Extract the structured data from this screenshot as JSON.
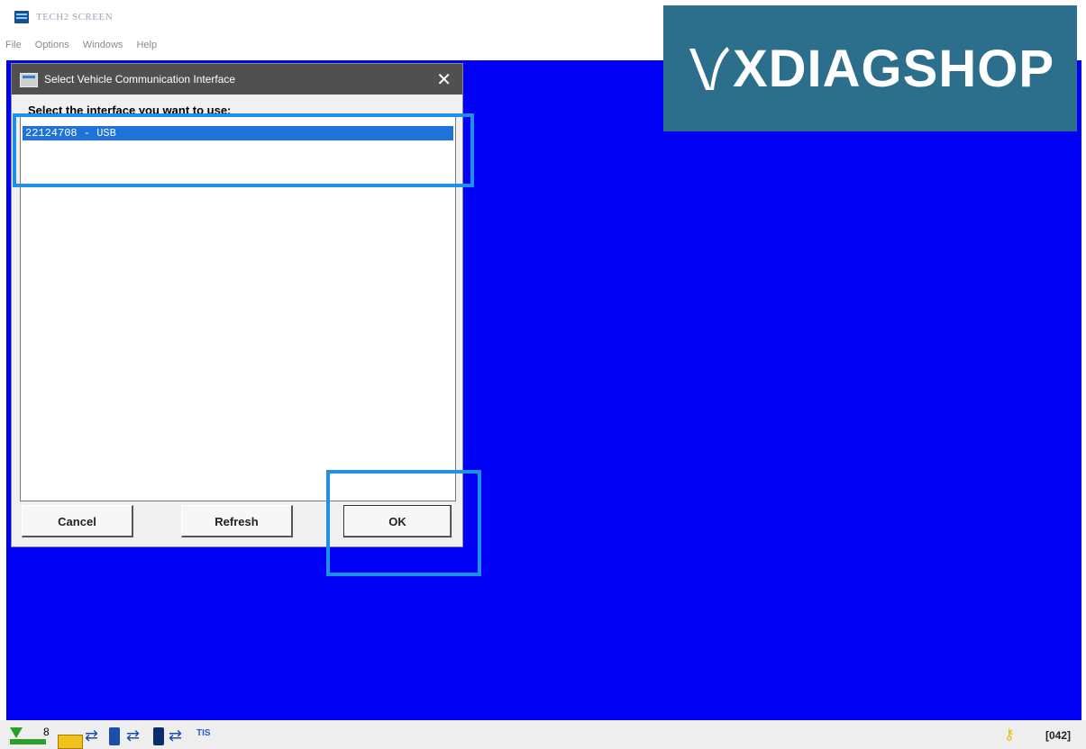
{
  "app": {
    "title": "TECH2 SCREEN",
    "menu": [
      "File",
      "Options",
      "Windows",
      "Help"
    ]
  },
  "watermark": {
    "text": "XDIAGSHOP"
  },
  "dialog": {
    "title": "Select Vehicle Communication Interface",
    "close_label": "✕",
    "prompt": "Select the interface you want to use:",
    "items": [
      "22124708 - USB"
    ],
    "buttons": {
      "cancel": "Cancel",
      "refresh": "Refresh",
      "ok": "OK"
    }
  },
  "taskbar": {
    "badge_count": "8",
    "tis_label": "TIS",
    "status_code": "[042]"
  },
  "colors": {
    "desktop_blue": "#0000f5",
    "highlight_outline": "#1e90e8",
    "selection_blue": "#1e72d8",
    "watermark_bg": "#2c6f8c"
  }
}
